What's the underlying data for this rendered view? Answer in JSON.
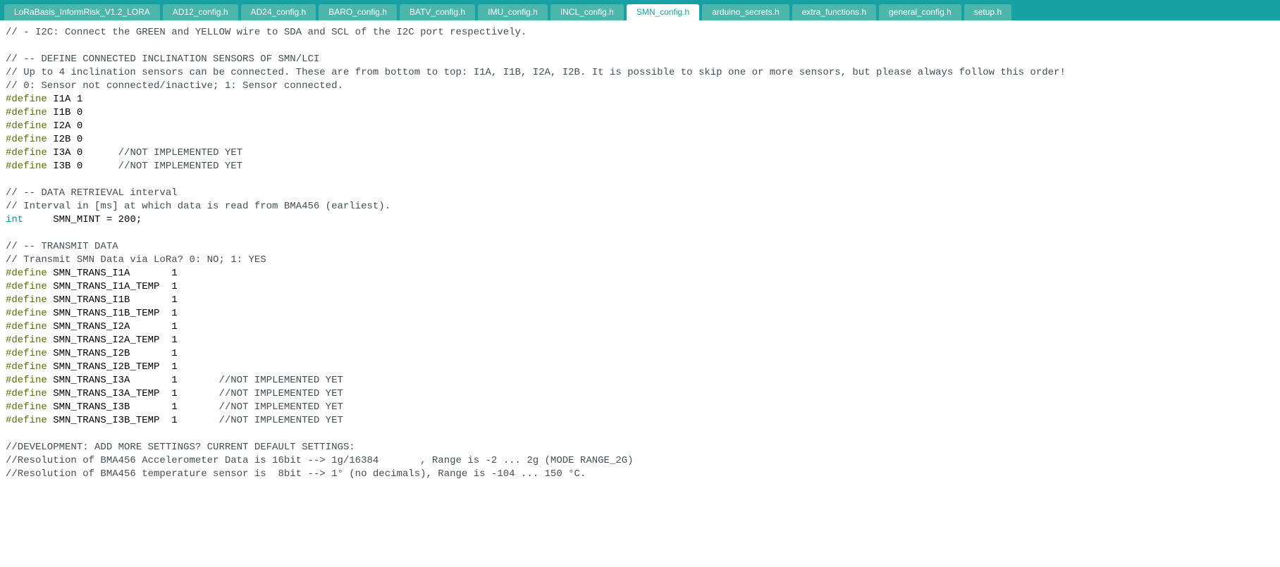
{
  "tabs": [
    {
      "label": "LoRaBasis_InformRisk_V1.2_LORA",
      "active": false
    },
    {
      "label": "AD12_config.h",
      "active": false
    },
    {
      "label": "AD24_config.h",
      "active": false
    },
    {
      "label": "BARO_config.h",
      "active": false
    },
    {
      "label": "BATV_config.h",
      "active": false
    },
    {
      "label": "IMU_config.h",
      "active": false
    },
    {
      "label": "INCL_config.h",
      "active": false
    },
    {
      "label": "SMN_config.h",
      "active": true
    },
    {
      "label": "arduino_secrets.h",
      "active": false
    },
    {
      "label": "extra_functions.h",
      "active": false
    },
    {
      "label": "general_config.h",
      "active": false
    },
    {
      "label": "setup.h",
      "active": false
    }
  ],
  "code_lines": [
    [
      {
        "cls": "comment",
        "t": "// - I2C: Connect the GREEN and YELLOW wire to SDA and SCL of the I2C port respectively."
      }
    ],
    [],
    [
      {
        "cls": "comment",
        "t": "// -- DEFINE CONNECTED INCLINATION SENSORS OF SMN/LCI"
      }
    ],
    [
      {
        "cls": "comment",
        "t": "// Up to 4 inclination sensors can be connected. These are from bottom to top: I1A, I1B, I2A, I2B. It is possible to skip one or more sensors, but please always follow this order!"
      }
    ],
    [
      {
        "cls": "comment",
        "t": "// 0: Sensor not connected/inactive; 1: Sensor connected."
      }
    ],
    [
      {
        "cls": "kw-define",
        "t": "#define"
      },
      {
        "cls": "plain",
        "t": " I1A 1"
      }
    ],
    [
      {
        "cls": "kw-define",
        "t": "#define"
      },
      {
        "cls": "plain",
        "t": " I1B 0"
      }
    ],
    [
      {
        "cls": "kw-define",
        "t": "#define"
      },
      {
        "cls": "plain",
        "t": " I2A 0"
      }
    ],
    [
      {
        "cls": "kw-define",
        "t": "#define"
      },
      {
        "cls": "plain",
        "t": " I2B 0"
      }
    ],
    [
      {
        "cls": "kw-define",
        "t": "#define"
      },
      {
        "cls": "plain",
        "t": " I3A 0      "
      },
      {
        "cls": "comment",
        "t": "//NOT IMPLEMENTED YET"
      }
    ],
    [
      {
        "cls": "kw-define",
        "t": "#define"
      },
      {
        "cls": "plain",
        "t": " I3B 0      "
      },
      {
        "cls": "comment",
        "t": "//NOT IMPLEMENTED YET"
      }
    ],
    [],
    [
      {
        "cls": "comment",
        "t": "// -- DATA RETRIEVAL interval"
      }
    ],
    [
      {
        "cls": "comment",
        "t": "// Interval in [ms] at which data is read from BMA456 (earliest)."
      }
    ],
    [
      {
        "cls": "kw-type",
        "t": "int"
      },
      {
        "cls": "plain",
        "t": "     SMN_MINT = 200;"
      }
    ],
    [],
    [
      {
        "cls": "comment",
        "t": "// -- TRANSMIT DATA"
      }
    ],
    [
      {
        "cls": "comment",
        "t": "// Transmit SMN Data via LoRa? 0: NO; 1: YES"
      }
    ],
    [
      {
        "cls": "kw-define",
        "t": "#define"
      },
      {
        "cls": "plain",
        "t": " SMN_TRANS_I1A       1"
      }
    ],
    [
      {
        "cls": "kw-define",
        "t": "#define"
      },
      {
        "cls": "plain",
        "t": " SMN_TRANS_I1A_TEMP  1"
      }
    ],
    [
      {
        "cls": "kw-define",
        "t": "#define"
      },
      {
        "cls": "plain",
        "t": " SMN_TRANS_I1B       1"
      }
    ],
    [
      {
        "cls": "kw-define",
        "t": "#define"
      },
      {
        "cls": "plain",
        "t": " SMN_TRANS_I1B_TEMP  1"
      }
    ],
    [
      {
        "cls": "kw-define",
        "t": "#define"
      },
      {
        "cls": "plain",
        "t": " SMN_TRANS_I2A       1"
      }
    ],
    [
      {
        "cls": "kw-define",
        "t": "#define"
      },
      {
        "cls": "plain",
        "t": " SMN_TRANS_I2A_TEMP  1"
      }
    ],
    [
      {
        "cls": "kw-define",
        "t": "#define"
      },
      {
        "cls": "plain",
        "t": " SMN_TRANS_I2B       1"
      }
    ],
    [
      {
        "cls": "kw-define",
        "t": "#define"
      },
      {
        "cls": "plain",
        "t": " SMN_TRANS_I2B_TEMP  1"
      }
    ],
    [
      {
        "cls": "kw-define",
        "t": "#define"
      },
      {
        "cls": "plain",
        "t": " SMN_TRANS_I3A       1       "
      },
      {
        "cls": "comment",
        "t": "//NOT IMPLEMENTED YET"
      }
    ],
    [
      {
        "cls": "kw-define",
        "t": "#define"
      },
      {
        "cls": "plain",
        "t": " SMN_TRANS_I3A_TEMP  1       "
      },
      {
        "cls": "comment",
        "t": "//NOT IMPLEMENTED YET"
      }
    ],
    [
      {
        "cls": "kw-define",
        "t": "#define"
      },
      {
        "cls": "plain",
        "t": " SMN_TRANS_I3B       1       "
      },
      {
        "cls": "comment",
        "t": "//NOT IMPLEMENTED YET"
      }
    ],
    [
      {
        "cls": "kw-define",
        "t": "#define"
      },
      {
        "cls": "plain",
        "t": " SMN_TRANS_I3B_TEMP  1       "
      },
      {
        "cls": "comment",
        "t": "//NOT IMPLEMENTED YET"
      }
    ],
    [],
    [
      {
        "cls": "comment",
        "t": "//DEVELOPMENT: ADD MORE SETTINGS? CURRENT DEFAULT SETTINGS:"
      }
    ],
    [
      {
        "cls": "comment",
        "t": "//Resolution of BMA456 Accelerometer Data is 16bit --> 1g/16384       , Range is -2 ... 2g (MODE RANGE_2G)"
      }
    ],
    [
      {
        "cls": "comment",
        "t": "//Resolution of BMA456 temperature sensor is  8bit --> 1° (no decimals), Range is -104 ... 150 °C."
      }
    ]
  ]
}
